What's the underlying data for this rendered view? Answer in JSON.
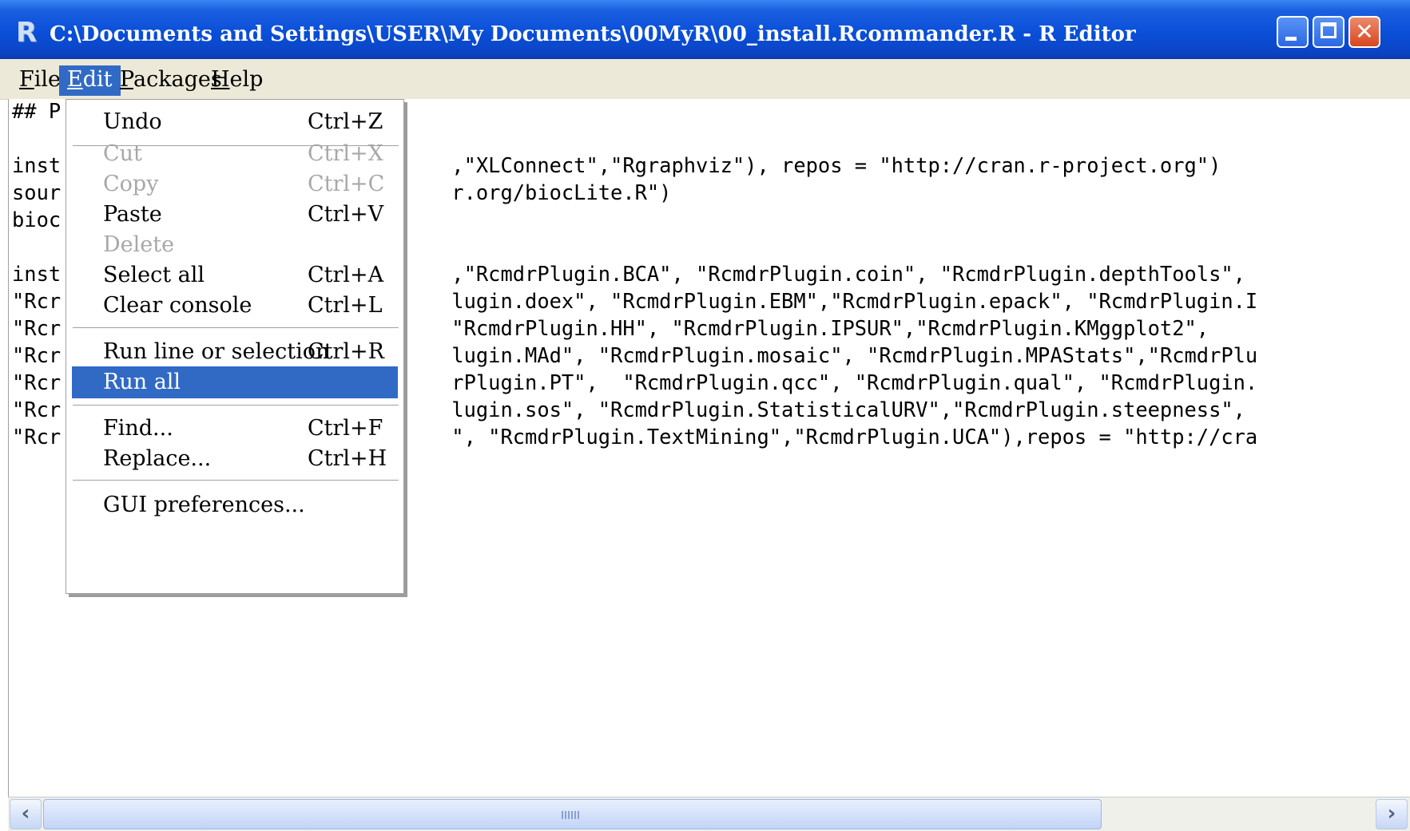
{
  "window": {
    "title": "C:\\Documents and Settings\\USER\\My Documents\\00MyR\\00_install.Rcommander.R - R Editor",
    "app_icon": "R"
  },
  "menubar": {
    "items": [
      {
        "label_mn": "F",
        "label_rest": "ile"
      },
      {
        "label_mn": "E",
        "label_rest": "dit"
      },
      {
        "label_mn": "P",
        "label_rest": "ackages"
      },
      {
        "label_mn": "H",
        "label_rest": "elp"
      }
    ]
  },
  "editor": {
    "lines": [
      "## P",
      "",
      "inst                                ,\"XLConnect\",\"Rgraphviz\"), repos = \"http://cran.r-project.org\")",
      "sour                                r.org/biocLite.R\")",
      "bioc",
      "",
      "inst                                ,\"RcmdrPlugin.BCA\", \"RcmdrPlugin.coin\", \"RcmdrPlugin.depthTools\",",
      "\"Rcr                                lugin.doex\", \"RcmdrPlugin.EBM\",\"RcmdrPlugin.epack\", \"RcmdrPlugin.I",
      "\"Rcr                                \"RcmdrPlugin.HH\", \"RcmdrPlugin.IPSUR\",\"RcmdrPlugin.KMggplot2\",",
      "\"Rcr                                lugin.MAd\", \"RcmdrPlugin.mosaic\", \"RcmdrPlugin.MPAStats\",\"RcmdrPlu",
      "\"Rcr                                rPlugin.PT\",  \"RcmdrPlugin.qcc\", \"RcmdrPlugin.qual\", \"RcmdrPlugin.",
      "\"Rcr                                lugin.sos\", \"RcmdrPlugin.StatisticalURV\",\"RcmdrPlugin.steepness\",",
      "\"Rcr                                \", \"RcmdrPlugin.TextMining\",\"RcmdrPlugin.UCA\"),repos = \"http://cra"
    ]
  },
  "edit_menu": {
    "items": [
      {
        "label": "Undo",
        "shortcut": "Ctrl+Z",
        "state": "enabled"
      },
      {
        "label": "Cut",
        "shortcut": "Ctrl+X",
        "state": "disabled"
      },
      {
        "label": "Copy",
        "shortcut": "Ctrl+C",
        "state": "disabled"
      },
      {
        "label": "Paste",
        "shortcut": "Ctrl+V",
        "state": "enabled"
      },
      {
        "label": "Delete",
        "shortcut": "",
        "state": "disabled"
      },
      {
        "label": "Select all",
        "shortcut": "Ctrl+A",
        "state": "enabled"
      },
      {
        "label": "Clear console",
        "shortcut": "Ctrl+L",
        "state": "enabled"
      },
      {
        "label": "Run line or selection",
        "shortcut": "Ctrl+R",
        "state": "enabled"
      },
      {
        "label": "Run all",
        "shortcut": "",
        "state": "selected"
      },
      {
        "label": "Find...",
        "shortcut": "Ctrl+F",
        "state": "enabled"
      },
      {
        "label": "Replace...",
        "shortcut": "Ctrl+H",
        "state": "enabled"
      },
      {
        "label": "GUI preferences...",
        "shortcut": "",
        "state": "enabled"
      }
    ]
  },
  "colors": {
    "titlebar": "#0a4fd8",
    "menubar": "#ece9d8",
    "selection": "#316ac5",
    "disabled_text": "#a8a8a8"
  }
}
